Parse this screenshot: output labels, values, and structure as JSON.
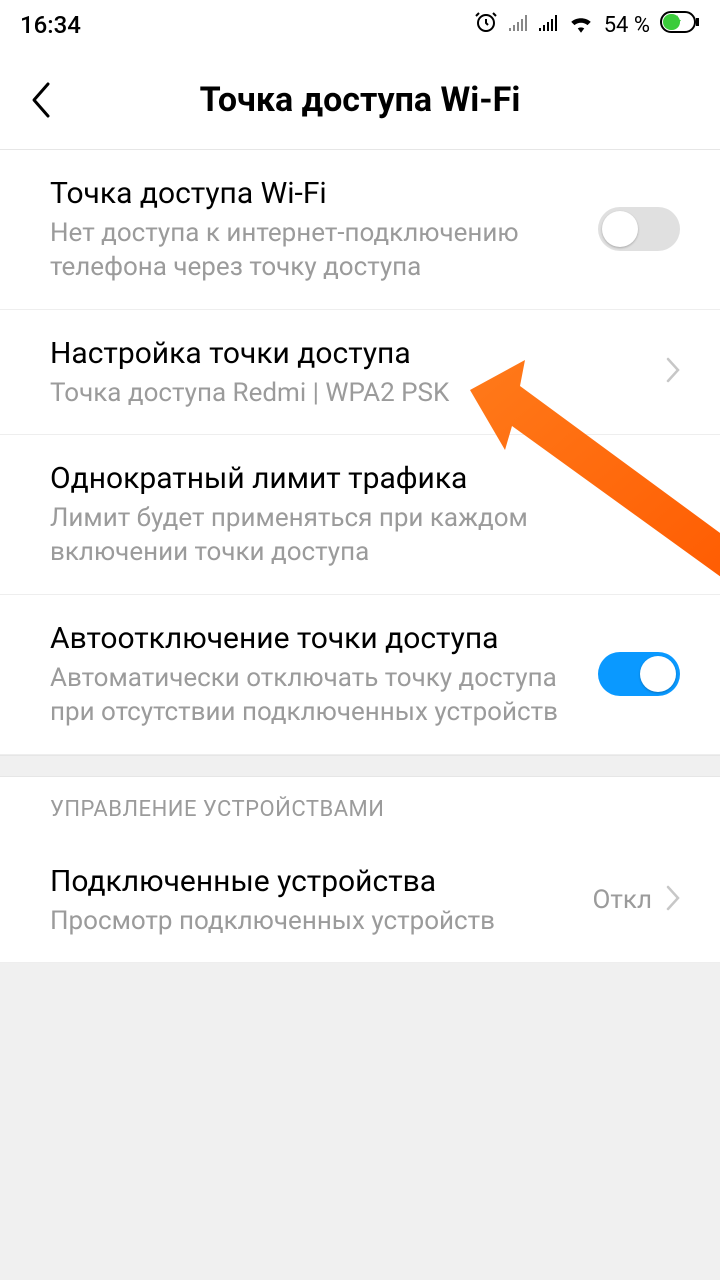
{
  "status": {
    "time": "16:34",
    "battery": "54 %"
  },
  "header": {
    "title": "Точка доступа Wi-Fi"
  },
  "rows": {
    "hotspot": {
      "title": "Точка доступа Wi-Fi",
      "sub": "Нет доступа к интернет-подключению телефона через точку доступа"
    },
    "setup": {
      "title": "Настройка точки доступа",
      "sub": "Точка доступа Redmi | WPA2 PSK"
    },
    "limit": {
      "title": "Однократный лимит трафика",
      "sub": "Лимит будет применяться при каждом включении точки доступа"
    },
    "auto_off": {
      "title": "Автоотключение точки доступа",
      "sub": "Автоматически отключать точку доступа при отсутствии подключенных устройств"
    },
    "devices": {
      "title": "Подключенные устройства",
      "sub": "Просмотр подключенных устройств",
      "value": "Откл"
    }
  },
  "section": {
    "devices_header": "УПРАВЛЕНИЕ УСТРОЙСТВАМИ"
  }
}
